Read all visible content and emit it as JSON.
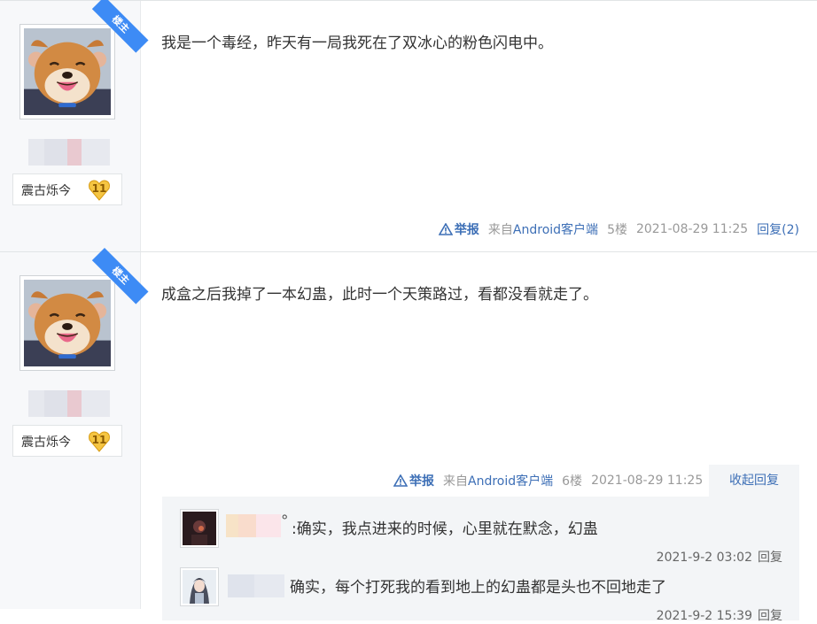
{
  "posts": [
    {
      "ribbon": "楼主",
      "badge_title": "震古烁今",
      "badge_level": "11",
      "content": "我是一个毒经，昨天有一局我死在了双冰心的粉色闪电中。",
      "report_label": "举报",
      "source_prefix": "来自",
      "source_client": "Android客户端",
      "floor": "5楼",
      "time": "2021-08-29 11:25",
      "reply_label": "回复(2)"
    },
    {
      "ribbon": "楼主",
      "badge_title": "震古烁今",
      "badge_level": "11",
      "content": "成盒之后我掉了一本幻蛊，此时一个天策路过，看都没看就走了。",
      "report_label": "举报",
      "source_prefix": "来自",
      "source_client": "Android客户端",
      "floor": "6楼",
      "time": "2021-08-29 11:25",
      "collapse_label": "收起回复",
      "replies": [
        {
          "separator": "°",
          "text": ":确实，我点进来的时候，心里就在默念，幻蛊",
          "time": "2021-9-2 03:02",
          "reply_label": "回复"
        },
        {
          "text": "确实，每个打死我的看到地上的幻蛊都是头也不回地走了",
          "time": "2021-9-2 15:39",
          "reply_label": "回复"
        }
      ]
    }
  ],
  "icons": {
    "avatar": "shiba-dog-avatar",
    "report": "warning-triangle-icon",
    "level": "heart-badge-icon"
  },
  "colors": {
    "link": "#3d6fb6",
    "ribbon": "#3d8bf5",
    "badge_gold": "#f5c542"
  }
}
